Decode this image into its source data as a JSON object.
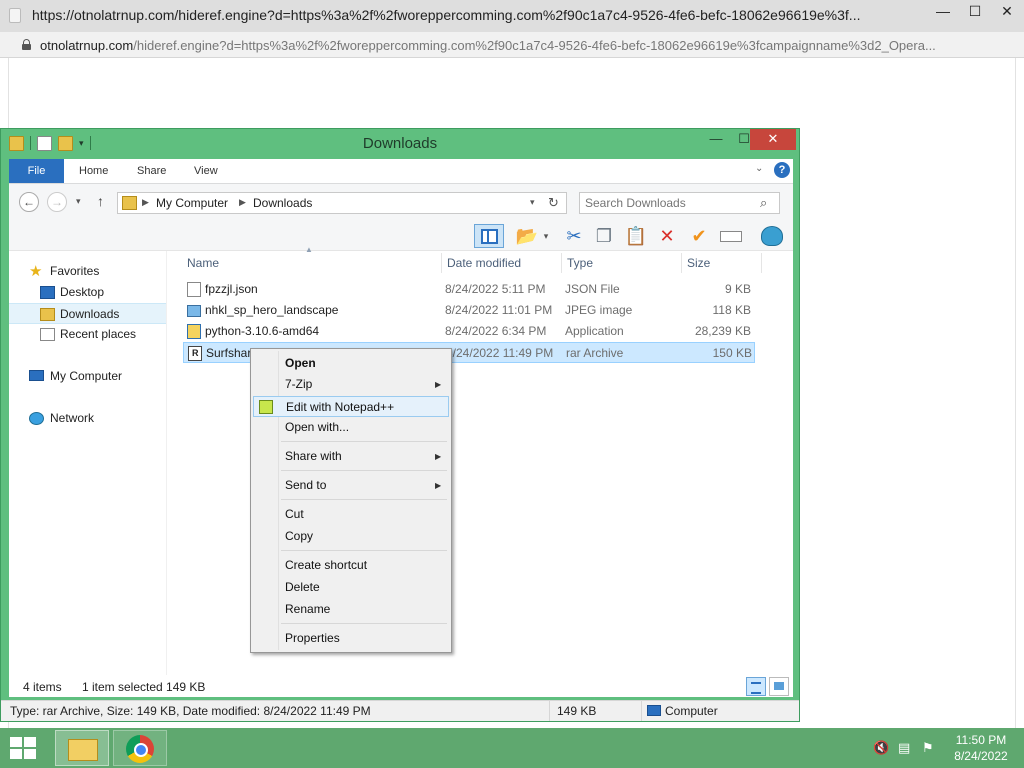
{
  "browser": {
    "title": "https://otnolatrnup.com/hideref.engine?d=https%3a%2f%2fworeppercomming.com%2f90c1a7c4-9526-4fe6-befc-18062e96619e%3f...",
    "url_domain": "otnolatrnup.com",
    "url_rest": "/hideref.engine?d=https%3a%2f%2fworeppercomming.com%2f90c1a7c4-9526-4fe6-befc-18062e96619e%3fcampaignname%3d2_Opera...",
    "controls": {
      "minimize": "—",
      "maximize": "☐",
      "close": "✕"
    }
  },
  "explorer": {
    "title": "Downloads",
    "controls": {
      "minimize": "—",
      "maximize": "☐",
      "close": "✕"
    },
    "ribbon_tabs": [
      "File",
      "Home",
      "Share",
      "View"
    ],
    "help": "?",
    "breadcrumb": [
      "My Computer",
      "Downloads"
    ],
    "search_placeholder": "Search Downloads",
    "nav": {
      "favorites": "Favorites",
      "desktop": "Desktop",
      "downloads": "Downloads",
      "recent": "Recent places",
      "computer": "My Computer",
      "network": "Network"
    },
    "columns": {
      "name": "Name",
      "date": "Date modified",
      "type": "Type",
      "size": "Size"
    },
    "files": [
      {
        "name": "fpzzjl.json",
        "date": "8/24/2022 5:11 PM",
        "type": "JSON File",
        "size": "9 KB"
      },
      {
        "name": "nhkl_sp_hero_landscape",
        "date": "8/24/2022 11:01 PM",
        "type": "JPEG image",
        "size": "118 KB"
      },
      {
        "name": "python-3.10.6-amd64",
        "date": "8/24/2022 6:34 PM",
        "type": "Application",
        "size": "28,239 KB"
      },
      {
        "name": "Surfshar",
        "date": "8/24/2022 11:49 PM",
        "type": "rar Archive",
        "size": "150 KB"
      }
    ],
    "status": {
      "items": "4 items",
      "selected": "1 item selected  149 KB"
    },
    "details": {
      "info": "Type: rar Archive, Size: 149 KB, Date modified: 8/24/2022 11:49 PM",
      "size": "149 KB",
      "location": "Computer"
    }
  },
  "context_menu": {
    "open": "Open",
    "zip": "7-Zip",
    "edit_npp": "Edit with Notepad++",
    "open_with": "Open with...",
    "share_with": "Share with",
    "send_to": "Send to",
    "cut": "Cut",
    "copy": "Copy",
    "create_shortcut": "Create shortcut",
    "delete": "Delete",
    "rename": "Rename",
    "properties": "Properties",
    "submenu_arrow": "▶"
  },
  "taskbar": {
    "time": "11:50 PM",
    "date": "8/24/2022"
  },
  "colors": {
    "window_frame": "#5fbf7f",
    "taskbar": "#5fa86f",
    "file_tab": "#2a6fbf",
    "close_button": "#c7463c",
    "selection": "#cce8ff"
  }
}
